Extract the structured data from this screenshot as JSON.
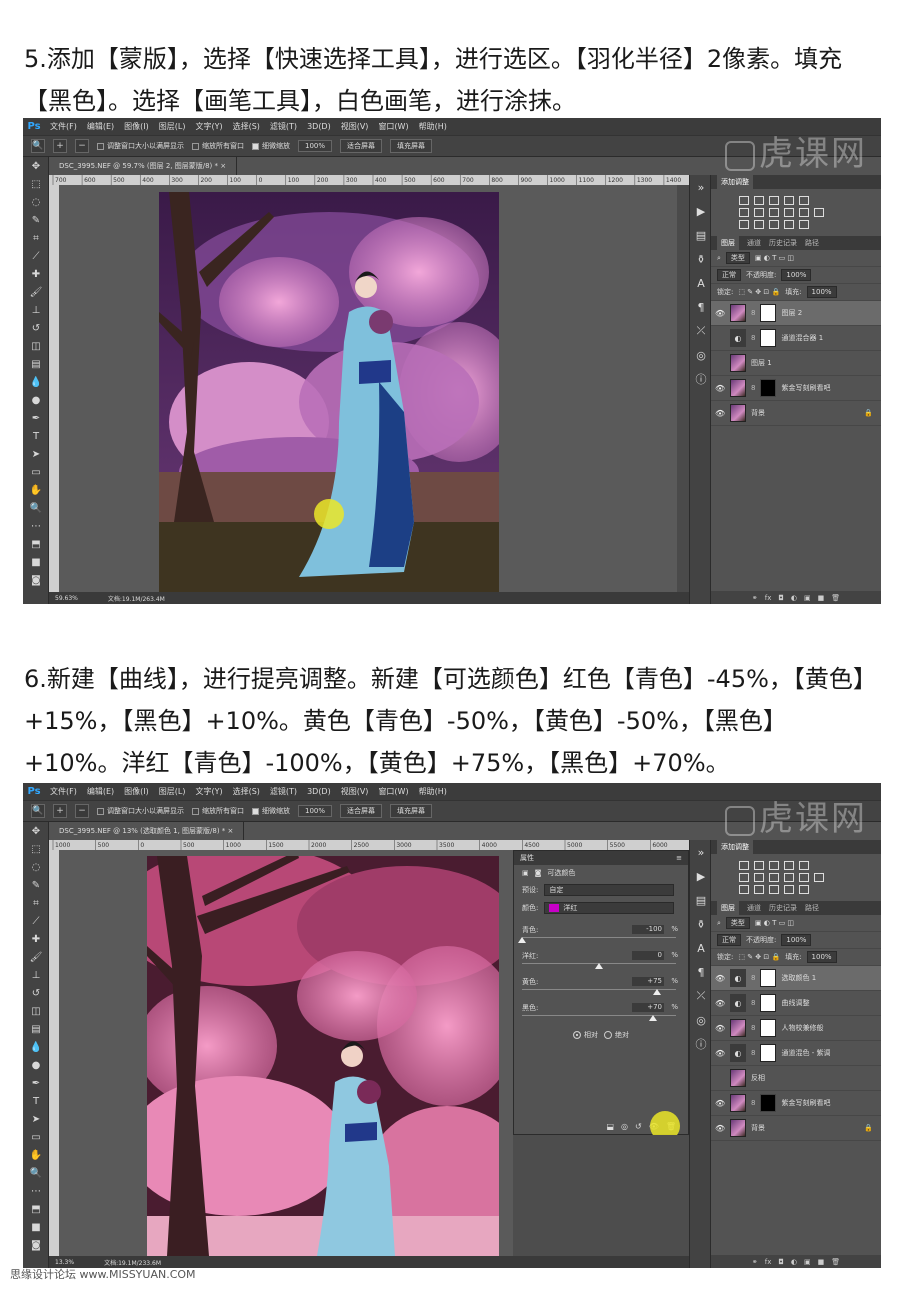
{
  "steps": [
    {
      "text": "5.添加【蒙版】，选择【快速选择工具】，进行选区。【羽化半径】2像素。填充【黑色】。选择【画笔工具】，白色画笔，进行涂抹。"
    },
    {
      "text": "6.新建【曲线】，进行提亮调整。新建【可选颜色】红色【青色】-45%，【黄色】+15%，【黑色】+10%。黄色【青色】-50%，【黄色】-50%，【黑色】+10%。洋红【青色】-100%，【黄色】+75%，【黑色】+70%。"
    }
  ],
  "ps": {
    "logo": "Ps",
    "menu": [
      "文件(F)",
      "编辑(E)",
      "图像(I)",
      "图层(L)",
      "文字(Y)",
      "选择(S)",
      "滤镜(T)",
      "3D(D)",
      "视图(V)",
      "窗口(W)",
      "帮助(H)"
    ],
    "options": {
      "resize_windows": "调整窗口大小以满屏显示",
      "zoom_all": "缩放所有窗口",
      "scrubby_zoom": "细微缩放",
      "zoom_value": "100%",
      "fit_screen": "适合屏幕",
      "fill_screen": "填充屏幕"
    },
    "watermark": "虎课网",
    "panel_tabs": [
      "图层",
      "通道",
      "历史记录",
      "路径"
    ],
    "adjust_title": "添加调整",
    "filter_kind": "类型",
    "blend_mode": "正常",
    "opacity_label": "不透明度:",
    "opacity_value": "100%",
    "lock_label": "锁定:",
    "fill_label": "填充:",
    "fill_value": "100%",
    "footer_icons": [
      "fx",
      "◘",
      "◐",
      "▣",
      "■",
      "🗑"
    ]
  },
  "shot1": {
    "doc_tab": "DSC_3995.NEF @ 59.7% (图层 2, 图层蒙版/8) * ×",
    "status_zoom": "59.63%",
    "status_doc": "文档:19.1M/263.4M",
    "ruler_marks": [
      "700",
      "600",
      "500",
      "400",
      "300",
      "200",
      "100",
      "0",
      "100",
      "200",
      "300",
      "400",
      "500",
      "600",
      "700",
      "800",
      "900",
      "1000",
      "1100",
      "1200",
      "1300",
      "1400"
    ],
    "layers": [
      {
        "name": "图层 2",
        "thumb": "photo",
        "mask": "white",
        "active": true,
        "visible": true
      },
      {
        "name": "通道混合器 1",
        "thumb": "adjust",
        "mask": "white",
        "active": false,
        "visible": false
      },
      {
        "name": "图层 1",
        "thumb": "photo",
        "mask": "",
        "active": false,
        "visible": false
      },
      {
        "name": "紫金写刻刷看吧",
        "thumb": "photo",
        "mask": "black",
        "active": false,
        "visible": true
      },
      {
        "name": "背景",
        "thumb": "photo",
        "mask": "",
        "active": false,
        "visible": true,
        "locked": true
      }
    ]
  },
  "shot2": {
    "doc_tab": "DSC_3995.NEF @ 13% (选取颜色 1, 图层蒙版/8) * ×",
    "status_zoom": "13.3%",
    "status_doc": "文档:19.1M/233.6M",
    "ruler_marks": [
      "1000",
      "500",
      "0",
      "500",
      "1000",
      "1500",
      "2000",
      "2500",
      "3000",
      "3500",
      "4000",
      "4500",
      "5000",
      "5500",
      "6000"
    ],
    "properties": {
      "title": "属性",
      "subtitle": "可选颜色",
      "preset_label": "预设:",
      "preset_value": "自定",
      "colors_label": "颜色:",
      "colors_value": "洋红",
      "colors_swatch": "#c800c8",
      "sliders": [
        {
          "label": "青色:",
          "value": "-100",
          "level": -100
        },
        {
          "label": "洋红:",
          "value": "0",
          "level": 0
        },
        {
          "label": "黄色:",
          "value": "+75",
          "level": 75
        },
        {
          "label": "黑色:",
          "value": "+70",
          "level": 70
        }
      ],
      "pct": "%",
      "relative": "相对",
      "absolute": "绝对"
    },
    "layers": [
      {
        "name": "选取颜色 1",
        "thumb": "adjust",
        "mask": "white",
        "active": true,
        "visible": true
      },
      {
        "name": "曲线调整",
        "thumb": "adjust",
        "mask": "white",
        "active": false,
        "visible": true
      },
      {
        "name": "人物校兼修般",
        "thumb": "photo",
        "mask": "white",
        "active": false,
        "visible": true
      },
      {
        "name": "通道混色 - 紫调",
        "thumb": "adjust",
        "mask": "white",
        "active": false,
        "visible": true
      },
      {
        "name": "反相",
        "thumb": "photo",
        "mask": "",
        "active": false,
        "visible": false
      },
      {
        "name": "紫金写刻刷看吧",
        "thumb": "photo",
        "mask": "black",
        "active": false,
        "visible": true
      },
      {
        "name": "背景",
        "thumb": "photo",
        "mask": "",
        "active": false,
        "visible": true,
        "locked": true
      }
    ]
  },
  "footer": "思缘设计论坛 www.MISSYUAN.COM"
}
